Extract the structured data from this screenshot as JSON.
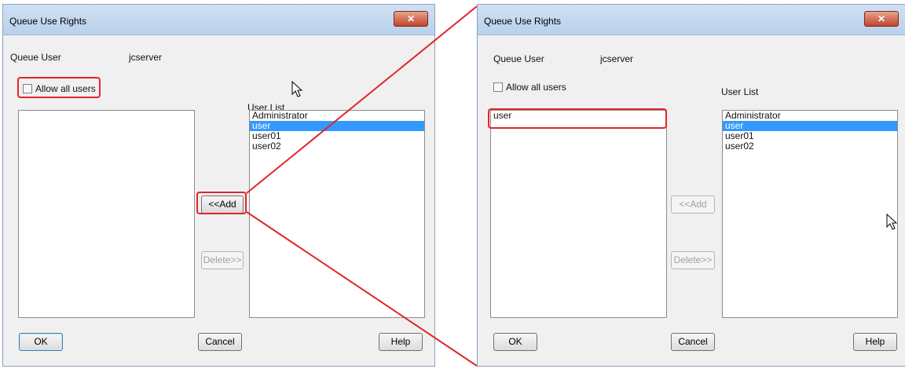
{
  "left": {
    "title": "Queue Use Rights",
    "close_glyph": "✕",
    "queue_user_label": "Queue User",
    "queue_user_value": "jcserver",
    "allow_all_label": "Allow all users",
    "user_list_label": "User List",
    "selected_items": [],
    "user_list": [
      "Administrator",
      "user",
      "user01",
      "user02"
    ],
    "user_list_selected_index": 1,
    "add_label": "<<Add",
    "delete_label": "Delete>>",
    "ok_label": "OK",
    "cancel_label": "Cancel",
    "help_label": "Help"
  },
  "right": {
    "title": "Queue Use Rights",
    "close_glyph": "✕",
    "queue_user_label": "Queue User",
    "queue_user_value": "jcserver",
    "allow_all_label": "Allow all users",
    "user_list_label": "User List",
    "selected_items": [
      "user"
    ],
    "user_list": [
      "Administrator",
      "user",
      "user01",
      "user02"
    ],
    "user_list_selected_index": 1,
    "add_label": "<<Add",
    "delete_label": "Delete>>",
    "ok_label": "OK",
    "cancel_label": "Cancel",
    "help_label": "Help"
  },
  "colors": {
    "highlight": "#e3242b",
    "selection": "#3399ff",
    "titlebar": "#c4d9f0"
  }
}
